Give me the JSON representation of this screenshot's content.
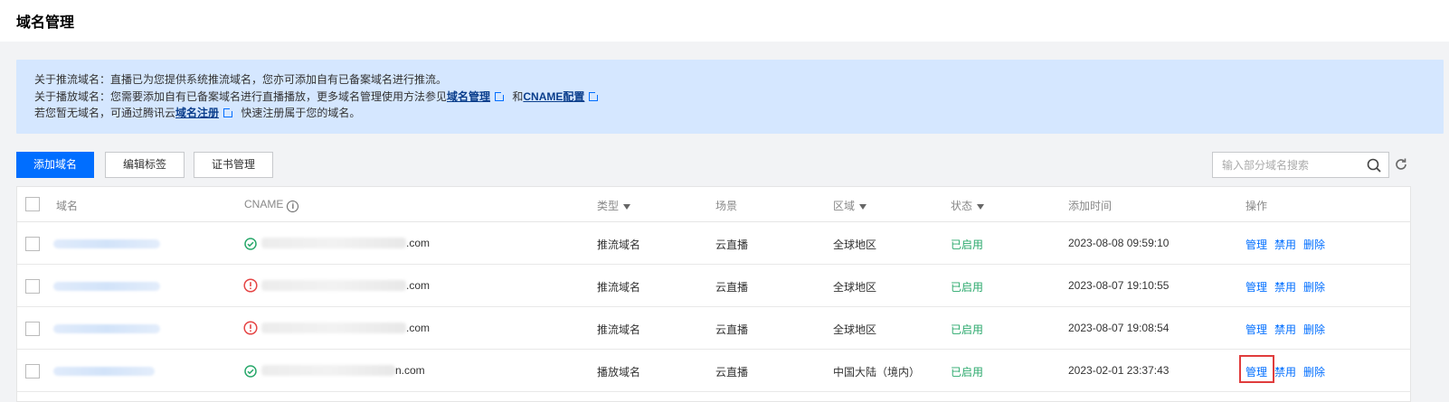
{
  "page": {
    "title": "域名管理"
  },
  "notice": {
    "line1": "关于推流域名：直播已为您提供系统推流域名，您亦可添加自有已备案域名进行推流。",
    "line2_prefix": "关于播放域名：您需要添加自有已备案域名进行直播播放，更多域名管理使用方法参见",
    "line2_link1": "域名管理",
    "line2_mid": "和",
    "line2_link2": "CNAME配置",
    "line3_prefix": "若您暂无域名，可通过腾讯云",
    "line3_link": "域名注册",
    "line3_suffix": "快速注册属于您的域名。"
  },
  "toolbar": {
    "add_domain": "添加域名",
    "edit_tags": "编辑标签",
    "cert_manage": "证书管理",
    "search_placeholder": "输入部分域名搜索"
  },
  "table": {
    "headers": {
      "domain": "域名",
      "cname": "CNAME",
      "type": "类型",
      "scene": "场景",
      "region": "区域",
      "status": "状态",
      "added_time": "添加时间",
      "actions": "操作"
    },
    "rows": [
      {
        "cname_suffix": ".com",
        "cname_status": "ok",
        "type": "推流域名",
        "scene": "云直播",
        "region": "全球地区",
        "status": "已启用",
        "added_time": "2023-08-08 09:59:10"
      },
      {
        "cname_suffix": ".com",
        "cname_status": "warn",
        "type": "推流域名",
        "scene": "云直播",
        "region": "全球地区",
        "status": "已启用",
        "added_time": "2023-08-07 19:10:55"
      },
      {
        "cname_suffix": ".com",
        "cname_status": "warn",
        "type": "推流域名",
        "scene": "云直播",
        "region": "全球地区",
        "status": "已启用",
        "added_time": "2023-08-07 19:08:54"
      },
      {
        "cname_suffix": "n.com",
        "cname_status": "ok",
        "type": "播放域名",
        "scene": "云直播",
        "region": "中国大陆（境内）",
        "status": "已启用",
        "added_time": "2023-02-01 23:37:43"
      }
    ],
    "actions": {
      "manage": "管理",
      "disable": "禁用",
      "delete": "删除"
    }
  },
  "colors": {
    "primary": "#006eff",
    "success": "#29a86b",
    "warning": "#e54545",
    "highlight": "#e03c3c"
  }
}
